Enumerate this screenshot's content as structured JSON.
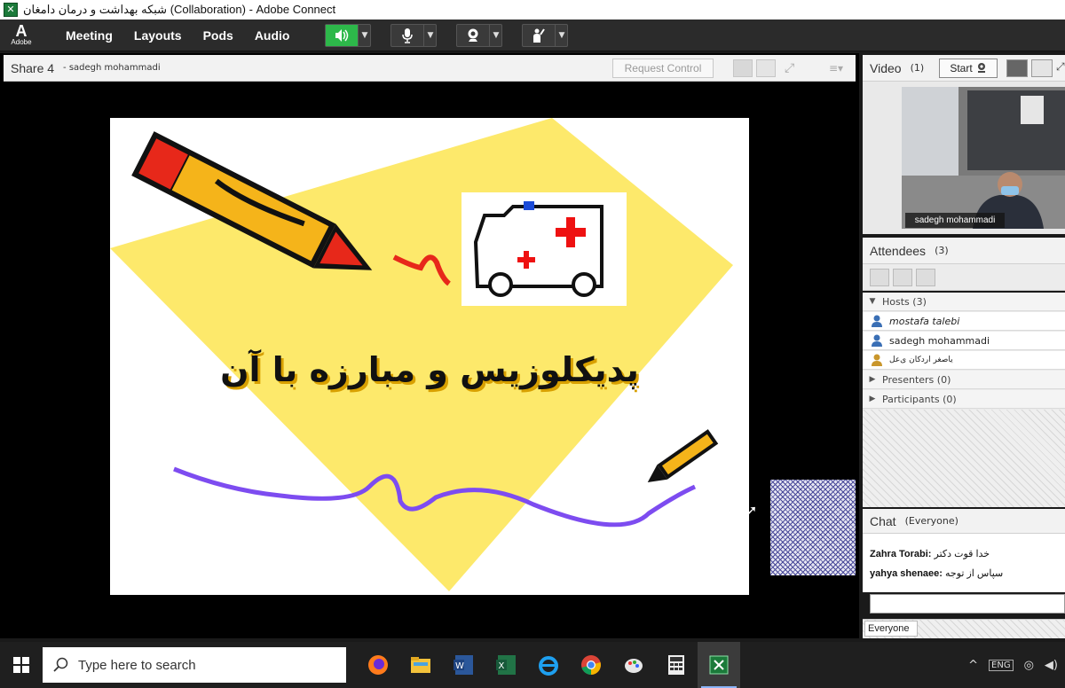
{
  "window": {
    "title": "شبکه بهداشت و درمان دامغان (Collaboration) - Adobe Connect",
    "app_icon": "adobe-connect-icon"
  },
  "menubar": {
    "logo_letter": "A",
    "logo_text": "Adobe",
    "items": [
      "Meeting",
      "Layouts",
      "Pods",
      "Audio"
    ],
    "controls": [
      "speaker-icon",
      "microphone-icon",
      "webcam-icon",
      "raise-hand-icon"
    ]
  },
  "share": {
    "title": "Share 4",
    "presenter": "- sadegh mohammadi",
    "request_control": "Request Control",
    "slide_title": "پدیکلوزیس و مبارزه با آن"
  },
  "video": {
    "title": "Video",
    "count": "(1)",
    "start": "Start",
    "participant_name": "sadegh mohammadi"
  },
  "attendees": {
    "title": "Attendees",
    "count": "(3)",
    "hosts": "Hosts (3)",
    "host_list": [
      "mostafa talebi",
      "sadegh mohammadi",
      "یاصغر اردکان ی‌عل"
    ],
    "presenters": "Presenters (0)",
    "participants": "Participants (0)"
  },
  "chat": {
    "title": "Chat",
    "scope": "(Everyone)",
    "messages": [
      {
        "sender": "Zahra Torabi:",
        "text": "خدا قوت دکتر"
      },
      {
        "sender": "yahya shenaee:",
        "text": "سپاس از توجه"
      }
    ],
    "recipient": "Everyone"
  },
  "taskbar": {
    "search_placeholder": "Type here to search",
    "apps": [
      "firefox-icon",
      "file-explorer-icon",
      "word-icon",
      "excel-icon",
      "internet-explorer-icon",
      "chrome-icon",
      "paint-icon",
      "calculator-icon",
      "adobe-connect-icon"
    ],
    "tray_lang": "ENG"
  },
  "colors": {
    "menubar": "#2b2b2b",
    "accent_green": "#2db84a",
    "slide_yellow": "#fde96b",
    "squiggle": "#7d4cf0"
  }
}
